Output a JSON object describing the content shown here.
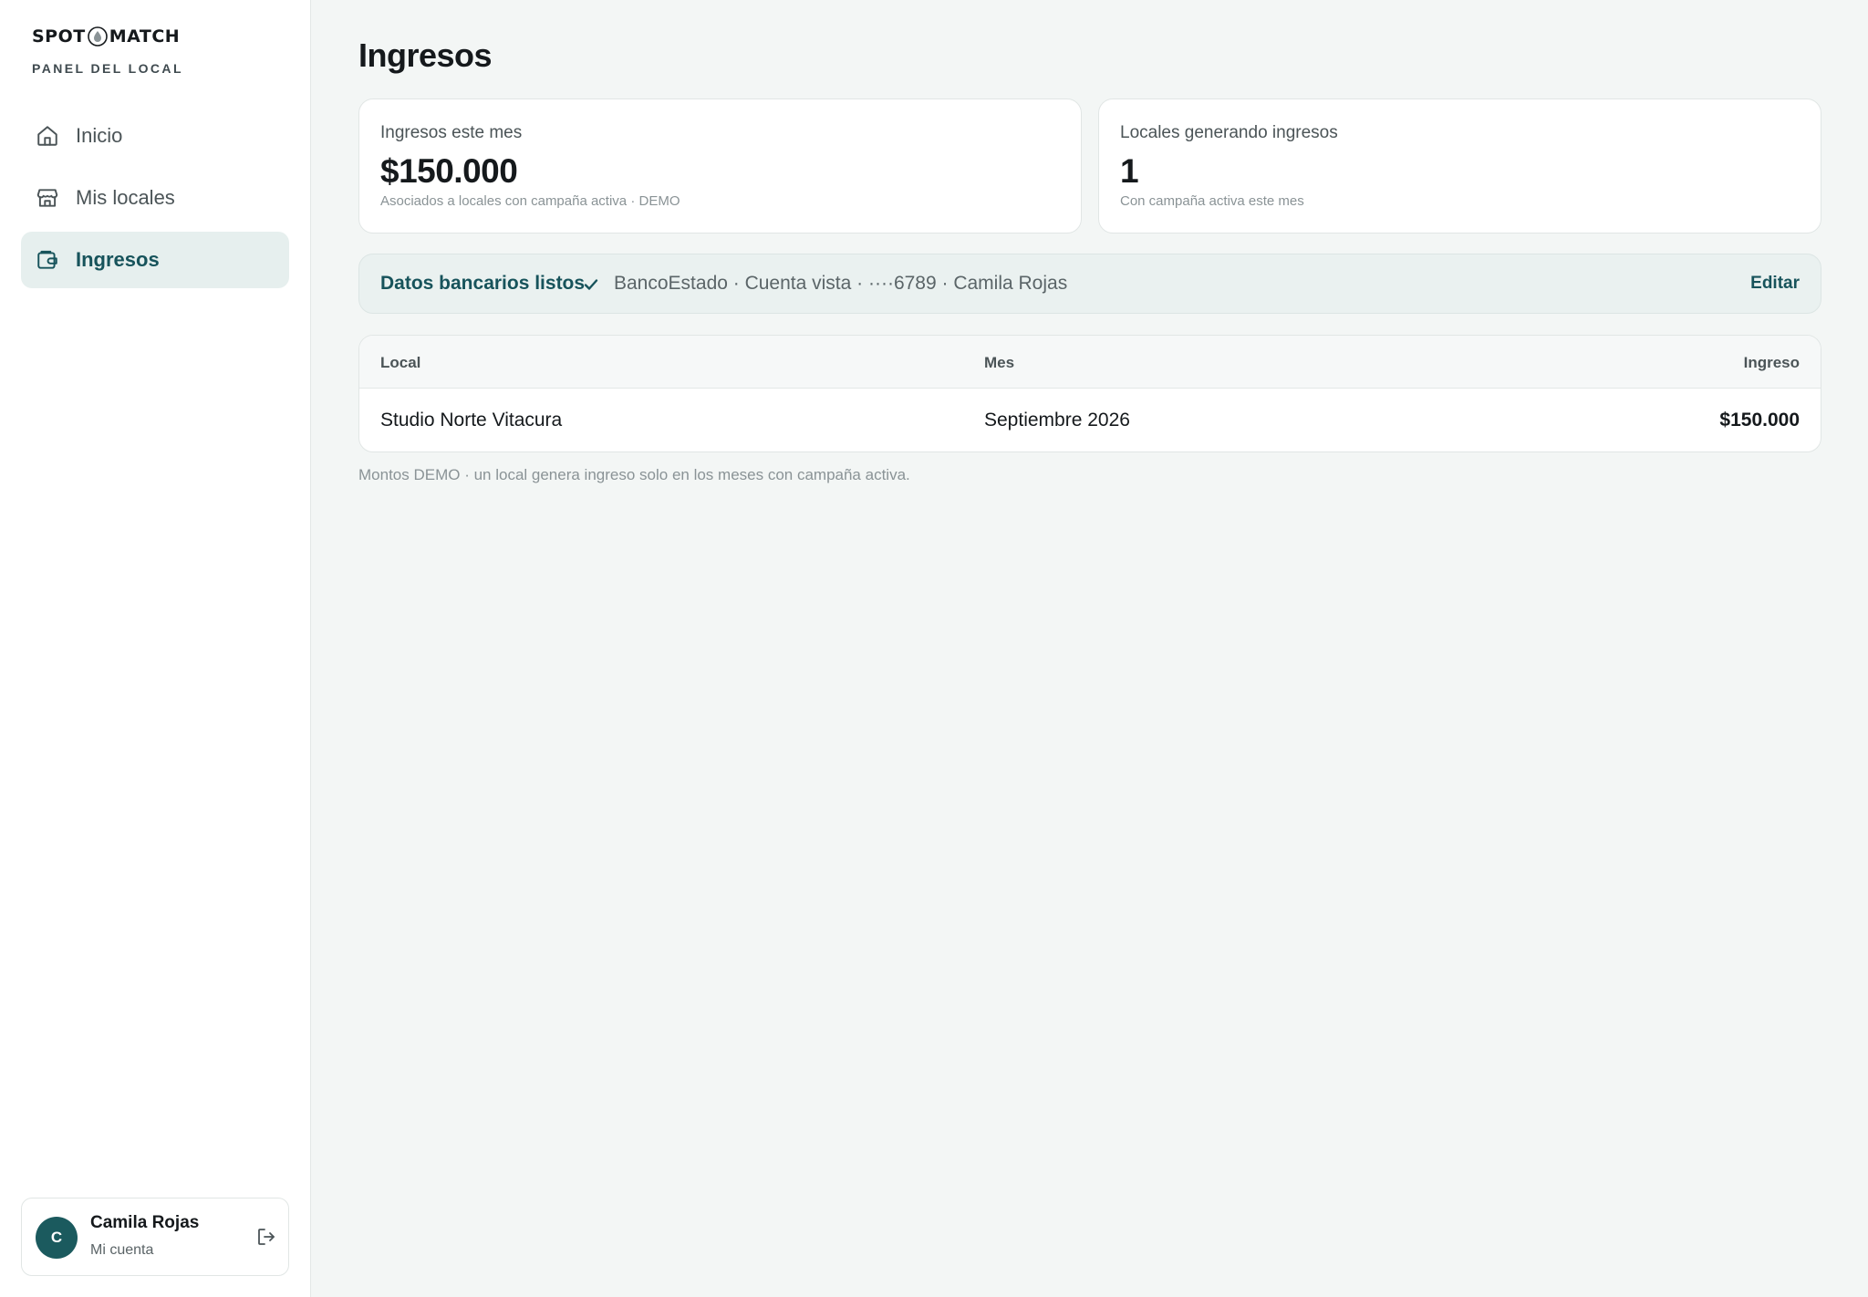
{
  "brand": {
    "logo_left": "SPOT",
    "logo_right": "MATCH",
    "subtitle": "PANEL DEL LOCAL"
  },
  "sidebar": {
    "items": [
      {
        "label": "Inicio",
        "icon": "home-icon",
        "active": false
      },
      {
        "label": "Mis locales",
        "icon": "store-icon",
        "active": false
      },
      {
        "label": "Ingresos",
        "icon": "wallet-icon",
        "active": true
      }
    ]
  },
  "account": {
    "initial": "C",
    "name": "Camila Rojas",
    "subtitle": "Mi cuenta",
    "logout_icon": "logout-icon"
  },
  "main": {
    "title": "Ingresos",
    "cards": [
      {
        "label": "Ingresos este mes",
        "value": "$150.000",
        "note": "Asociados a locales con campaña activa · DEMO"
      },
      {
        "label": "Locales generando ingresos",
        "value": "1",
        "note": "Con campaña activa este mes"
      }
    ],
    "bank": {
      "title": "Datos bancarios listos",
      "info": "BancoEstado · Cuenta vista · ····6789 · Camila Rojas",
      "edit_label": "Editar"
    },
    "table": {
      "headers": [
        "Local",
        "Mes",
        "Ingreso"
      ],
      "rows": [
        [
          "Studio Norte Vitacura",
          "Septiembre 2026",
          "$150.000"
        ]
      ]
    },
    "footnote": "Montos DEMO · un local genera ingreso solo en los meses con campaña activa."
  },
  "colors": {
    "accent": "#17535b",
    "avatar": "#1b5a5e",
    "background": "#f3f6f5",
    "active_nav": "#e6efee"
  }
}
